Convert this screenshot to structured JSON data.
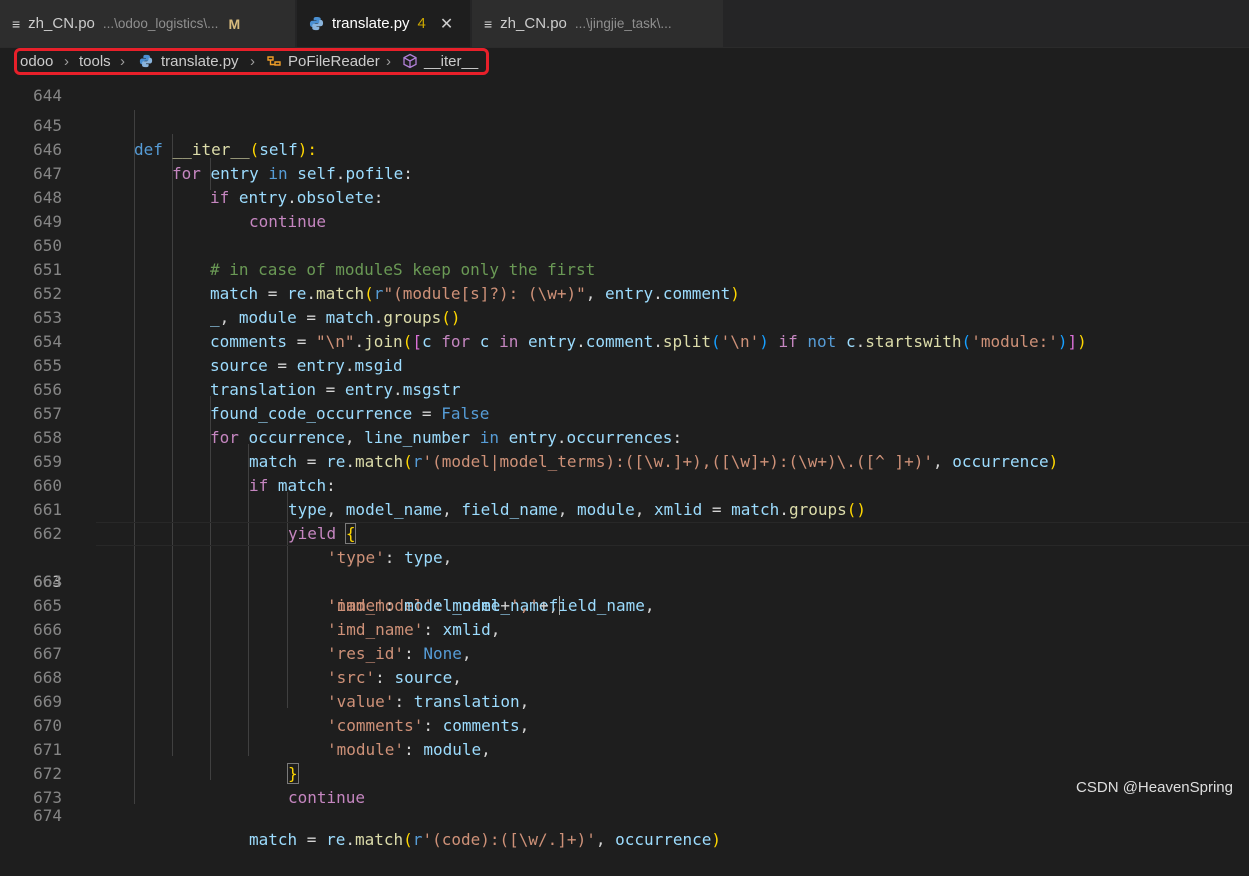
{
  "tabs": [
    {
      "name": "zh_CN.po",
      "path": "...\\odoo_logistics\\...",
      "status": "M",
      "active": false
    },
    {
      "name": "translate.py",
      "problems": "4",
      "active": true
    },
    {
      "name": "zh_CN.po",
      "path": "...\\jingjie_task\\...",
      "active": false
    }
  ],
  "breadcrumb": {
    "items": [
      "odoo",
      "tools",
      "translate.py",
      "PoFileReader",
      "__iter__"
    ]
  },
  "editor": {
    "current_line": "663",
    "line_numbers": [
      "644",
      "645",
      "646",
      "647",
      "648",
      "649",
      "650",
      "651",
      "652",
      "653",
      "654",
      "655",
      "656",
      "657",
      "658",
      "659",
      "660",
      "661",
      "662",
      "663",
      "664",
      "665",
      "666",
      "667",
      "668",
      "669",
      "670",
      "671",
      "672",
      "673",
      "674"
    ],
    "code": {
      "l645": [
        "def",
        "__iter__",
        "(",
        "self",
        "):"
      ],
      "l646": [
        "for",
        "entry",
        "in",
        "self",
        ".",
        "pofile",
        ":"
      ],
      "l647": [
        "if",
        "entry",
        ".",
        "obsolete",
        ":"
      ],
      "l648": [
        "continue"
      ],
      "l650": [
        "# in case of moduleS keep only the first"
      ],
      "l651": [
        "match",
        " = ",
        "re",
        ".",
        "match",
        "(",
        "r",
        "\"(module[s]?): (\\w+)\"",
        ", ",
        "entry",
        ".",
        "comment",
        ")"
      ],
      "l652": [
        "_",
        ", ",
        "module",
        " = ",
        "match",
        ".",
        "groups",
        "()"
      ],
      "l653": [
        "comments",
        " = ",
        "\"\\n\"",
        ".",
        "join",
        "(",
        "[",
        "c",
        " ",
        "for",
        " ",
        "c",
        " ",
        "in",
        " ",
        "entry",
        ".",
        "comment",
        ".",
        "split",
        "(",
        "'\\n'",
        ")",
        " ",
        "if",
        " ",
        "not",
        " ",
        "c",
        ".",
        "startswith",
        "(",
        "'module:'",
        ")",
        "]",
        ")"
      ],
      "l654": [
        "source",
        " = ",
        "entry",
        ".",
        "msgid"
      ],
      "l655": [
        "translation",
        " = ",
        "entry",
        ".",
        "msgstr"
      ],
      "l656": [
        "found_code_occurrence",
        " = ",
        "False"
      ],
      "l657": [
        "for",
        " ",
        "occurrence",
        ", ",
        "line_number",
        " ",
        "in",
        " ",
        "entry",
        ".",
        "occurrences",
        ":"
      ],
      "l658": [
        "match",
        " = ",
        "re",
        ".",
        "match",
        "(",
        "r",
        "'(model|model_terms):([\\w.]+),([\\w]+):(\\w+)\\.([^ ]+)'",
        ", ",
        "occurrence",
        ")"
      ],
      "l659": [
        "if",
        " ",
        "match",
        ":"
      ],
      "l660": [
        "type",
        ", ",
        "model_name",
        ", ",
        "field_name",
        ", ",
        "module",
        ", ",
        "xmlid",
        " = ",
        "match",
        ".",
        "groups",
        "()"
      ],
      "l661": [
        "yield",
        " ",
        "{"
      ],
      "l662": [
        "'type'",
        ": ",
        "type",
        ","
      ],
      "l663": [
        "'imd_model'",
        ": ",
        "model_name",
        ","
      ],
      "l664": [
        "'name'",
        ": ",
        "model_name",
        "+",
        "','",
        "+",
        "field_name",
        ","
      ],
      "l665": [
        "'imd_name'",
        ": ",
        "xmlid",
        ","
      ],
      "l666": [
        "'res_id'",
        ": ",
        "None",
        ","
      ],
      "l667": [
        "'src'",
        ": ",
        "source",
        ","
      ],
      "l668": [
        "'value'",
        ": ",
        "translation",
        ","
      ],
      "l669": [
        "'comments'",
        ": ",
        "comments",
        ","
      ],
      "l670": [
        "'module'",
        ": ",
        "module",
        ","
      ],
      "l671": [
        "}"
      ],
      "l672": [
        "continue"
      ],
      "l674": [
        "match",
        " = ",
        "re",
        ".",
        "match",
        "(",
        "r",
        "'(code):([\\w/.]+)'",
        ", ",
        "occurrence",
        ")"
      ]
    }
  },
  "watermark": "CSDN @HeavenSpring",
  "colors": {
    "accent_red": "#e8202a",
    "editor_bg": "#1e1e1e"
  }
}
